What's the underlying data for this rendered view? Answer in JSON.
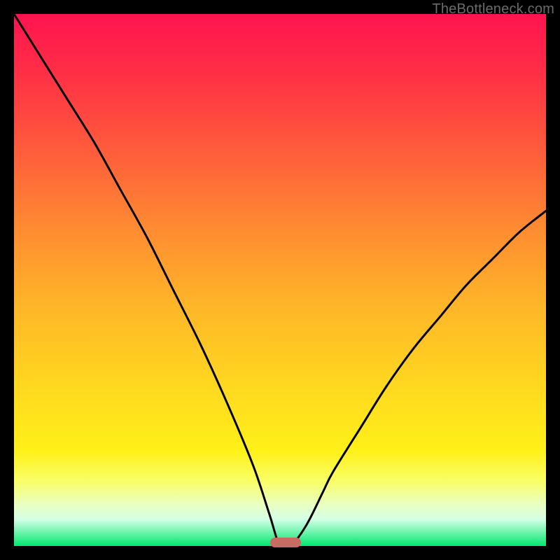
{
  "watermark": "TheBottleneck.com",
  "colors": {
    "frame": "#000000",
    "gradient_top": "#ff1450",
    "gradient_bottom": "#00e86e",
    "curve": "#000000",
    "marker": "#c96a63"
  },
  "chart_data": {
    "type": "line",
    "title": "",
    "xlabel": "",
    "ylabel": "",
    "xlim": [
      0,
      100
    ],
    "ylim": [
      0,
      100
    ],
    "grid": false,
    "legend": false,
    "series": [
      {
        "name": "bottleneck-curve",
        "x": [
          0,
          5,
          10,
          15,
          20,
          25,
          30,
          35,
          40,
          45,
          48,
          50,
          52,
          55,
          58,
          60,
          65,
          70,
          75,
          80,
          85,
          90,
          95,
          100
        ],
        "values": [
          100,
          92,
          84,
          76,
          67,
          58,
          48,
          38,
          27,
          15,
          6,
          0,
          0,
          4,
          10,
          14,
          22,
          30,
          37,
          43,
          49,
          54,
          59,
          63
        ]
      }
    ],
    "marker": {
      "x": 51,
      "y": 0,
      "shape": "rounded-bar"
    },
    "notes": "Values estimated from pixel positions; y is percentage of plot height from bottom; minimum (optimal point) near x≈50–52."
  }
}
